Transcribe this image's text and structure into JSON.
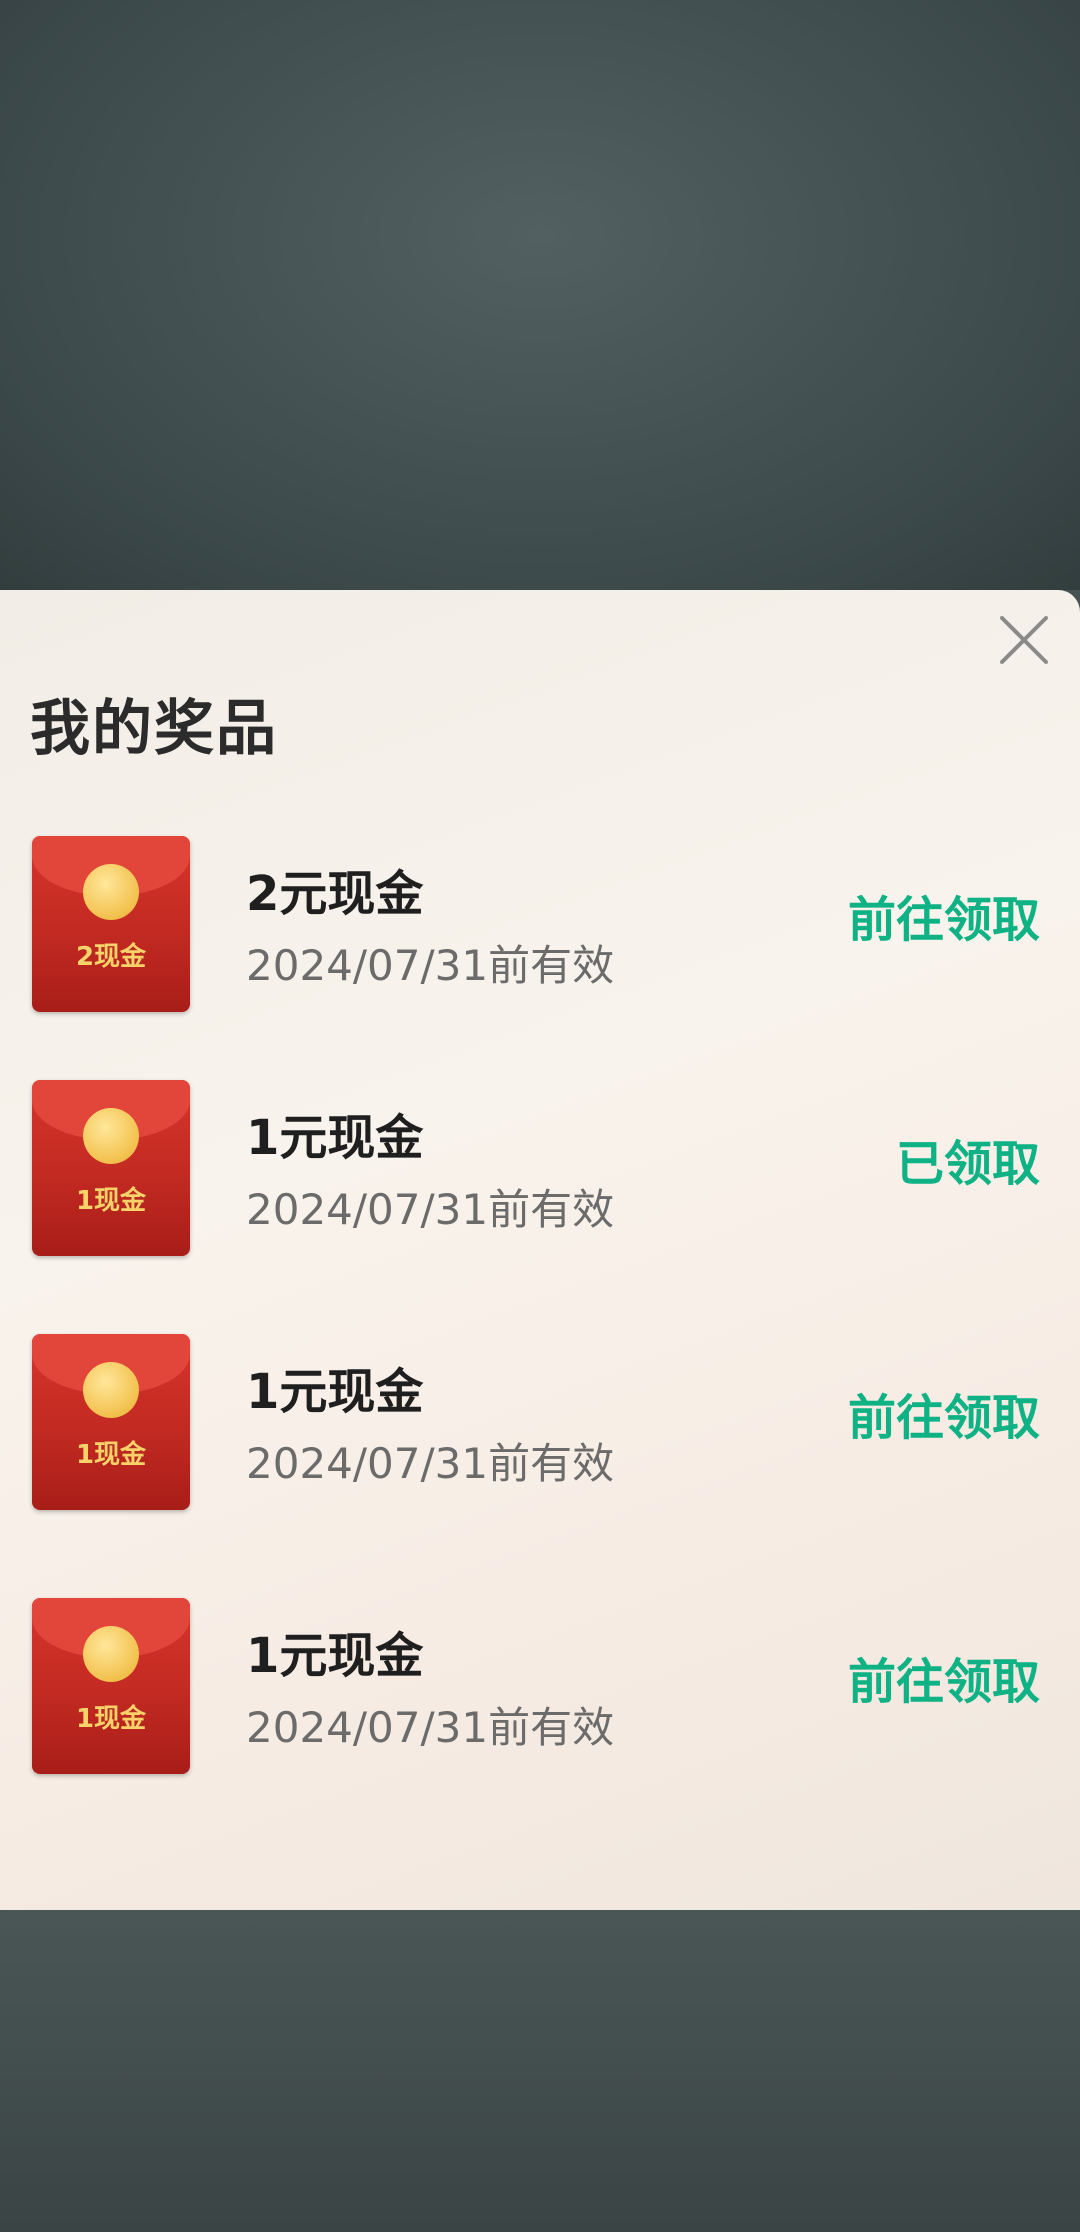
{
  "dialog": {
    "title": "我的奖品",
    "close_icon": "close-icon"
  },
  "prizes": [
    {
      "name": "2元现金",
      "validity": "2024/07/31前有效",
      "action": "前往领取",
      "envelope_label": "2现金"
    },
    {
      "name": "1元现金",
      "validity": "2024/07/31前有效",
      "action": "已领取",
      "envelope_label": "1现金"
    },
    {
      "name": "1元现金",
      "validity": "2024/07/31前有效",
      "action": "前往领取",
      "envelope_label": "1现金"
    },
    {
      "name": "1元现金",
      "validity": "2024/07/31前有效",
      "action": "前往领取",
      "envelope_label": "1现金"
    }
  ],
  "colors": {
    "action_green": "#0fb284",
    "envelope_red": "#c22a22",
    "coin_gold": "#f2c14d"
  }
}
